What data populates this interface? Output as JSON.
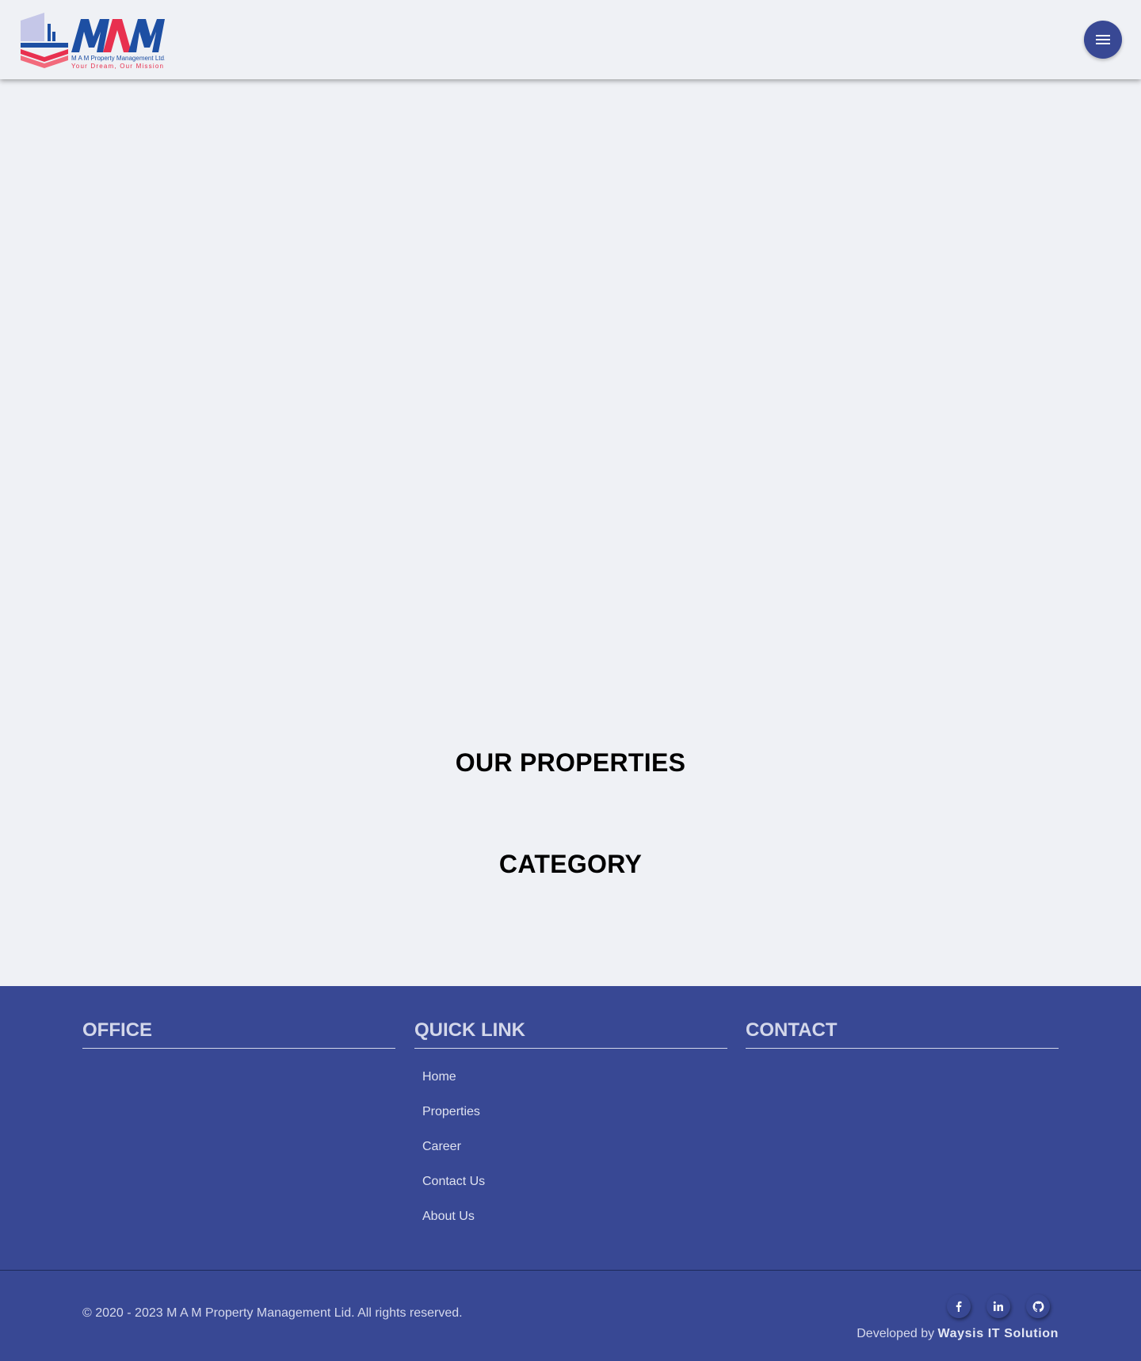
{
  "header": {
    "logo": {
      "icon": "mam-building-logo-icon",
      "company_name": "M A M Property Management Ltd.",
      "tagline": "Your Dream, Our Mission"
    },
    "menu_icon": "hamburger-menu-icon"
  },
  "sections": {
    "properties_title": "OUR PROPERTIES",
    "category_title": "CATEGORY"
  },
  "footer": {
    "office_title": "OFFICE",
    "quick_link_title": "QUICK LINK",
    "contact_title": "CONTACT",
    "quick_links": [
      {
        "label": "Home"
      },
      {
        "label": "Properties"
      },
      {
        "label": "Career"
      },
      {
        "label": "Contact Us"
      },
      {
        "label": "About Us"
      }
    ],
    "copyright": "© 2020 - 2023 M A M Property Management Lid. All rights reserved.",
    "developed_by_prefix": "Developed by",
    "developer_name": "Waysis IT Solution",
    "social_icons": [
      "facebook-icon",
      "linkedin-icon",
      "github-icon"
    ]
  },
  "colors": {
    "page_background": "#eff1f5",
    "accent_blue": "#384894",
    "logo_red": "#e8304f",
    "logo_blue": "#1d4fa3",
    "footer_text": "#d6d9ec"
  }
}
